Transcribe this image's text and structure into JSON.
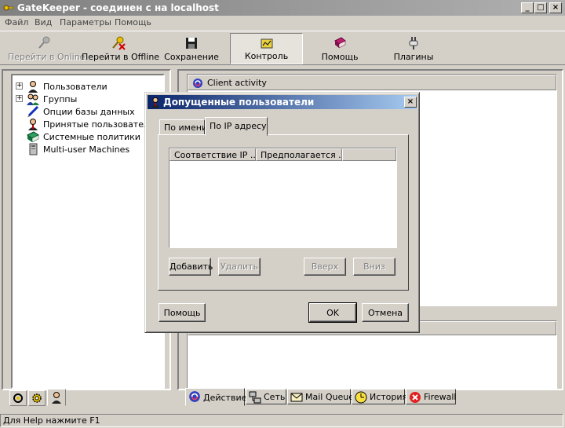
{
  "window": {
    "title": "GateKeeper - соединен с на localhost",
    "controls": [
      "_",
      "□",
      "×"
    ]
  },
  "menu": [
    "Файл",
    "Вид",
    "Параметры",
    "Помощь"
  ],
  "toolbar": [
    {
      "label": "Перейти в Online",
      "icon": "key-icon",
      "state": "disabled"
    },
    {
      "label": "Перейти в Offline",
      "icon": "key-x-icon",
      "state": "normal"
    },
    {
      "label": "Сохранение",
      "icon": "floppy-icon",
      "state": "normal"
    },
    {
      "label": "Контроль",
      "icon": "monitor-icon",
      "state": "pressed"
    },
    {
      "label": "Помощь",
      "icon": "book-icon",
      "state": "normal"
    },
    {
      "label": "Плагины",
      "icon": "plug-icon",
      "state": "normal"
    }
  ],
  "tree": [
    {
      "label": "Пользователи",
      "icon": "user-icon",
      "expandable": true
    },
    {
      "label": "Группы",
      "icon": "group-icon",
      "expandable": true
    },
    {
      "label": "Опции базы данных",
      "icon": "pen-icon",
      "expandable": false
    },
    {
      "label": "Принятые пользователи",
      "icon": "user-icon",
      "expandable": false
    },
    {
      "label": "Системные политики",
      "icon": "policy-book-icon",
      "expandable": false
    },
    {
      "label": "Multi-user Machines",
      "icon": "machine-icon",
      "expandable": false
    }
  ],
  "right_panel": {
    "header": "Client activity"
  },
  "bottom_tabs": [
    {
      "label": "Действие",
      "icon": "activity-icon",
      "active": true
    },
    {
      "label": "Сеть",
      "icon": "network-icon",
      "active": false
    },
    {
      "label": "Mail Queue",
      "icon": "mail-icon",
      "active": false
    },
    {
      "label": "История",
      "icon": "clock-icon",
      "active": false
    },
    {
      "label": "Firewall",
      "icon": "stop-icon",
      "active": false
    }
  ],
  "left_bottom_tabs": [
    "gear-stack-icon",
    "gears-icon",
    "user-small-icon"
  ],
  "status": "Для Help нажмите F1",
  "dialog": {
    "title": "Допущенные пользователи",
    "tabs": [
      {
        "label": "По имени",
        "active": false
      },
      {
        "label": "По IP адресу",
        "active": true
      }
    ],
    "columns": [
      "Соответствие IP ...",
      "Предполагается ..."
    ],
    "buttons": {
      "add": "Добавить",
      "delete": "Удалить",
      "up": "Вверх",
      "down": "Вниз",
      "help": "Помощь",
      "ok": "OK",
      "cancel": "Отмена"
    }
  },
  "colors": {
    "title_active": "#0a246a",
    "title_inactive": "#808080",
    "face": "#d4d0c8"
  }
}
